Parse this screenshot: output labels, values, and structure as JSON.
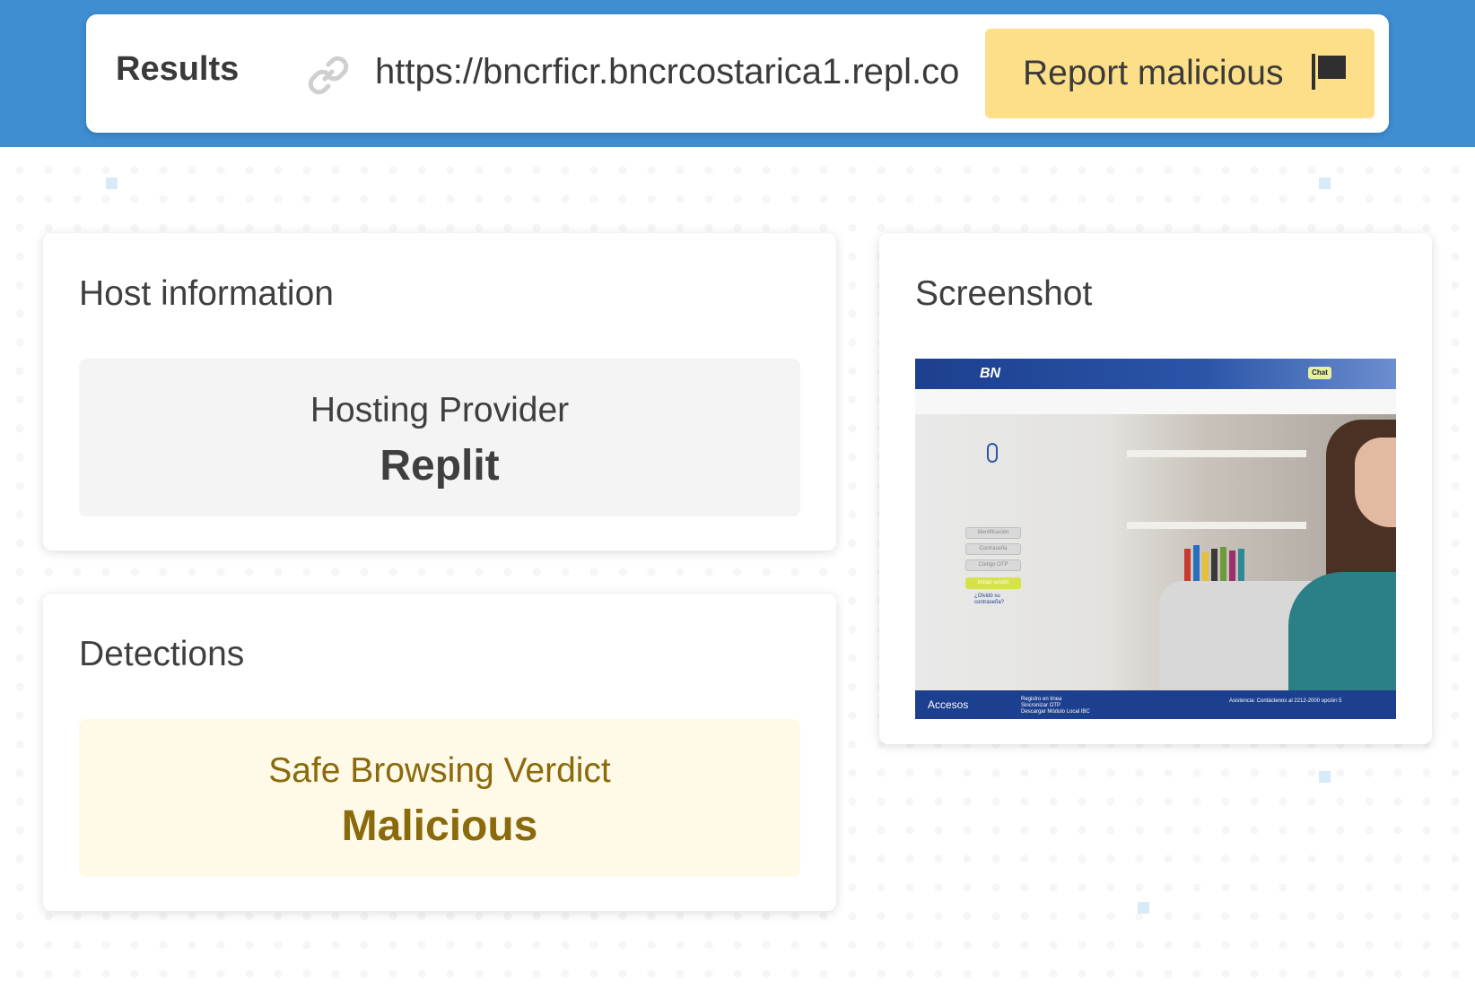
{
  "header": {
    "title": "Results",
    "url": "https://bncrficr.bncrcostarica1.repl.co",
    "report_button": "Report malicious",
    "link_icon": "link-icon",
    "flag_icon": "flag-icon"
  },
  "host_info": {
    "title": "Host information",
    "label": "Hosting Provider",
    "value": "Replit"
  },
  "detections": {
    "title": "Detections",
    "label": "Safe Browsing Verdict",
    "value": "Malicious",
    "color": "#8a6a0b"
  },
  "screenshot": {
    "title": "Screenshot",
    "logo": "BN",
    "chat": "Chat",
    "fields": [
      "Identificación",
      "Contraseña",
      "Código OTP"
    ],
    "login_button": "Iniciar sesión",
    "forgot": "¿Olvidó su contraseña?",
    "footer_title": "Accesos",
    "footer_links": [
      "Registro en línea",
      "Sincronizar OTP",
      "Descargar Módulo Local IBC"
    ],
    "footer_help": "Asistencia: Contáctenos al 2212-2000 opción 5"
  },
  "colors": {
    "top_band": "#3f8ed2",
    "report_button": "#fddf8a",
    "detection_bg": "#fff9e8"
  }
}
